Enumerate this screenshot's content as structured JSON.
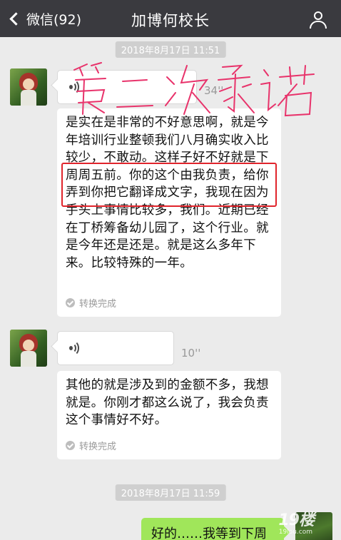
{
  "nav": {
    "back_label": "微信(92)",
    "title": "加博何校长"
  },
  "messages": [
    {
      "timestamp": "2018年8月17日 11:51",
      "duration": "34''",
      "transcript": "是实在是非常的不好意思啊，就是今年培训行业整顿我们八月确实收入比较少，不敢动。这样子好不好就是下周周五前。你的这个由我负责，给你弄到你把它翻译成文字，我现在因为手头上事情比较多，我们。近期已经在丁桥筹备幼儿园了，这个行业。就是今年还是还是。就是这么多年下来。比较特殊的一年。",
      "status": "转换完成",
      "annotation": "第二次承诺"
    },
    {
      "duration": "10''",
      "transcript": "其他的就是涉及到的金额不多，我想就是。你刚才都这么说了，我会负责这个事情好不好。",
      "status": "转换完成"
    },
    {
      "timestamp": "2018年8月17日 11:59",
      "reply": "好的……我等到下周"
    }
  ],
  "watermark": {
    "text": "19楼",
    "sub": "19lou.com"
  },
  "colors": {
    "nav_bg": "#3a3a3f",
    "chat_bg": "#ebebeb",
    "self_bubble": "#a0e65a",
    "highlight": "#e0242b",
    "handwriting": "#e8336b"
  }
}
